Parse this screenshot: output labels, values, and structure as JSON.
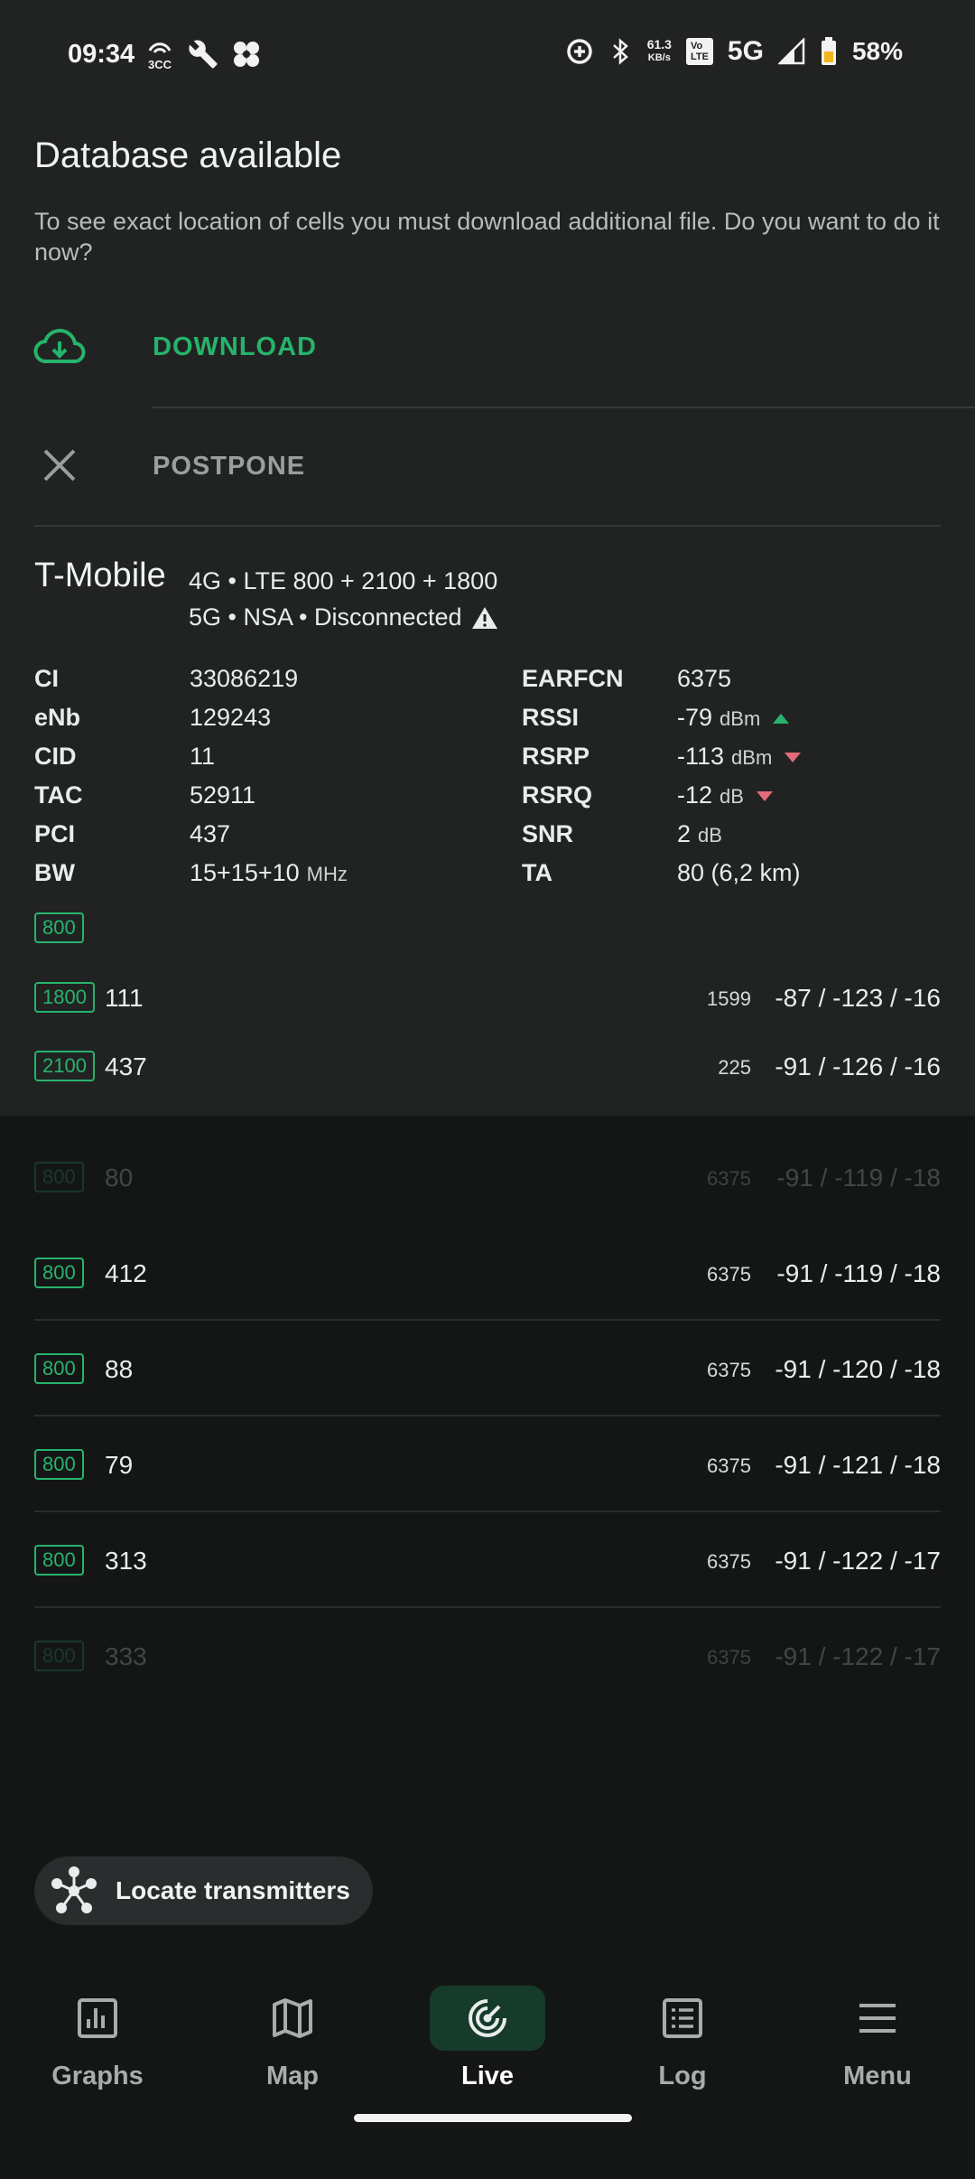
{
  "status_bar": {
    "time": "09:34",
    "left_icons": [
      "3cc-icon",
      "wrench-icon",
      "app-icon"
    ],
    "speed_value": "61.3",
    "speed_unit": "KB/s",
    "volte_top": "Vo",
    "volte_bottom": "LTE",
    "network": "5G",
    "battery": "58%"
  },
  "dialog": {
    "title": "Database available",
    "text": "To see exact location of cells you must download additional file. Do you want to do it now?",
    "download_label": "DOWNLOAD",
    "postpone_label": "POSTPONE"
  },
  "operator": {
    "name": "T-Mobile",
    "line1": "4G • LTE 800 + 2100 + 1800",
    "line2": "5G • NSA • Disconnected"
  },
  "params_left": [
    {
      "k": "CI",
      "v": "33086219"
    },
    {
      "k": "eNb",
      "v": "129243"
    },
    {
      "k": "CID",
      "v": "11"
    },
    {
      "k": "TAC",
      "v": "52911"
    },
    {
      "k": "PCI",
      "v": "437"
    },
    {
      "k": "BW",
      "v": "15+15+10",
      "unit": "MHz"
    }
  ],
  "params_right": [
    {
      "k": "EARFCN",
      "v": "6375"
    },
    {
      "k": "RSSI",
      "v": "-79",
      "unit": "dBm",
      "trend": "up"
    },
    {
      "k": "RSRP",
      "v": "-113",
      "unit": "dBm",
      "trend": "down"
    },
    {
      "k": "RSRQ",
      "v": "-12",
      "unit": "dB",
      "trend": "down"
    },
    {
      "k": "SNR",
      "v": "2",
      "unit": "dB"
    },
    {
      "k": "TA",
      "v": "80 (6,2 km)"
    }
  ],
  "primary_band": "800",
  "aggregated_cells": [
    {
      "band": "1800",
      "pci": "111",
      "earfcn": "1599",
      "signal": "-87 / -123 / -16"
    },
    {
      "band": "2100",
      "pci": "437",
      "earfcn": "225",
      "signal": "-91 / -126 / -16"
    }
  ],
  "neighbor_cells": [
    {
      "band": "800",
      "pci": "80",
      "earfcn": "6375",
      "signal": "-91 / -119 / -18"
    },
    {
      "band": "800",
      "pci": "412",
      "earfcn": "6375",
      "signal": "-91 / -119 / -18"
    },
    {
      "band": "800",
      "pci": "88",
      "earfcn": "6375",
      "signal": "-91 / -120 / -18"
    },
    {
      "band": "800",
      "pci": "79",
      "earfcn": "6375",
      "signal": "-91 / -121 / -18"
    },
    {
      "band": "800",
      "pci": "313",
      "earfcn": "6375",
      "signal": "-91 / -122 / -17"
    },
    {
      "band": "800",
      "pci": "333",
      "earfcn": "6375",
      "signal": "-91 / -122 / -17"
    }
  ],
  "locate_label": "Locate transmitters",
  "nav": [
    {
      "label": "Graphs",
      "icon": "graphs-icon"
    },
    {
      "label": "Map",
      "icon": "map-icon"
    },
    {
      "label": "Live",
      "icon": "live-icon"
    },
    {
      "label": "Log",
      "icon": "log-icon"
    },
    {
      "label": "Menu",
      "icon": "menu-icon"
    }
  ],
  "colors": {
    "accent": "#27b36b",
    "down_trend": "#e56b7a",
    "background": "#141616",
    "panel": "#212323"
  }
}
